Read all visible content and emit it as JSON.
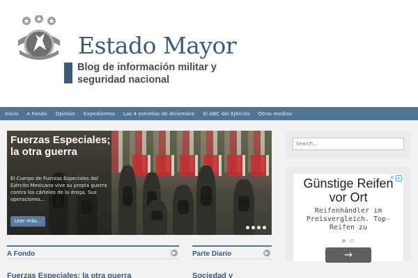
{
  "header": {
    "site_title": "Estado Mayor",
    "tagline": "Blog de información militar y seguridad nacional"
  },
  "nav": {
    "items": [
      "Inicio",
      "A Fondo",
      "Opinión",
      "Expedientes",
      "Las 4 estrellas de diciembre",
      "El ABC del Ejército",
      "Otros medios"
    ]
  },
  "slider": {
    "title": "Fuerzas Especiales; la otra guerra",
    "excerpt": "El Cuerpo de Fuerzas Especiales del Ejército Mexicano vive su propia guerra contra los cárteles de la droga. Sus operaciones...",
    "read_more": "Leer más..."
  },
  "sidebar": {
    "search_placeholder": "Search..."
  },
  "ad": {
    "headline": "Günstige Reifen vor Ort",
    "body": "Reifenhändler im Preisvergleich. Top-Reifen zu",
    "button_glyph": "→"
  },
  "sections": [
    {
      "label": "A Fondo",
      "post_title": "Fuerzas Especiales; la otra guerra"
    },
    {
      "label": "Parte Diario",
      "post_title": "Sociedad y"
    }
  ],
  "colors": {
    "brand": "#3d5a78",
    "nav_bg": "#4f7494",
    "button": "#5a7aa3"
  }
}
